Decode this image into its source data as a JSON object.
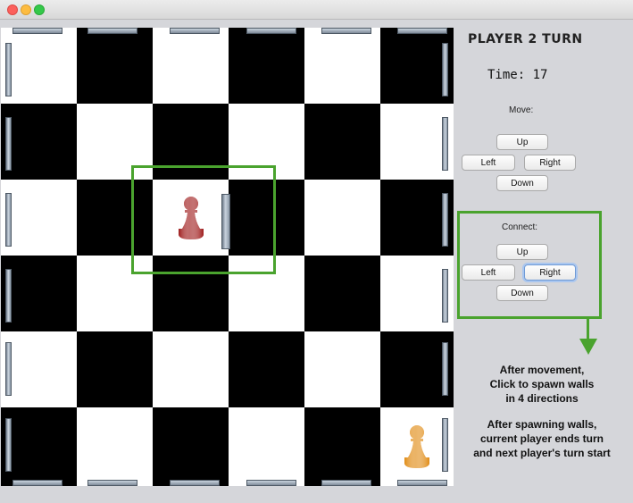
{
  "window": {
    "buttons": [
      "close",
      "minimize",
      "maximize"
    ]
  },
  "sidebar": {
    "turn_title": "PLAYER 2 TURN",
    "timer_label": "Time:",
    "timer_value": "17",
    "move_label": "Move:",
    "move_buttons": {
      "up": "Up",
      "left": "Left",
      "right": "Right",
      "down": "Down"
    },
    "connect_label": "Connect:",
    "connect_buttons": {
      "up": "Up",
      "left": "Left",
      "right": "Right",
      "down": "Down"
    }
  },
  "annotations": {
    "note1": [
      "After movement,",
      "Click to spawn walls",
      "in 4 directions"
    ],
    "note2": [
      "After spawning walls,",
      "current player ends turn",
      "and next player's turn start"
    ]
  },
  "board": {
    "size": [
      6,
      6
    ],
    "pieces": [
      {
        "name": "red-pawn",
        "row": 2,
        "col": 2,
        "color": "#9e1a1a"
      },
      {
        "name": "orange-pawn",
        "row": 5,
        "col": 5,
        "color": "#e08a12"
      }
    ]
  },
  "colors": {
    "highlight": "#4aa32e",
    "light_square": "#ffffff",
    "dark_square": "#000000"
  }
}
